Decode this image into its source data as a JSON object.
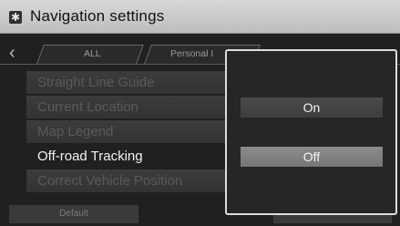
{
  "header": {
    "title": "Navigation settings",
    "icon": "gear-icon"
  },
  "tabs": [
    {
      "label": "ALL"
    },
    {
      "label": "Personal I"
    }
  ],
  "menu_items": [
    {
      "label": "Straight Line Guide",
      "state": "disabled"
    },
    {
      "label": "Current Location",
      "state": "disabled"
    },
    {
      "label": "Map Legend",
      "state": "disabled"
    },
    {
      "label": "Off-road Tracking",
      "state": "active"
    },
    {
      "label": "Correct Vehicle Position",
      "state": "disabled"
    }
  ],
  "bottom": {
    "default_label": "Default",
    "ok_label": ""
  },
  "popup": {
    "options": [
      {
        "label": "On",
        "selected": false
      },
      {
        "label": "Off",
        "selected": true
      }
    ]
  },
  "colors": {
    "selected_option": "#808080",
    "title_bar": "#cfcfcf"
  }
}
